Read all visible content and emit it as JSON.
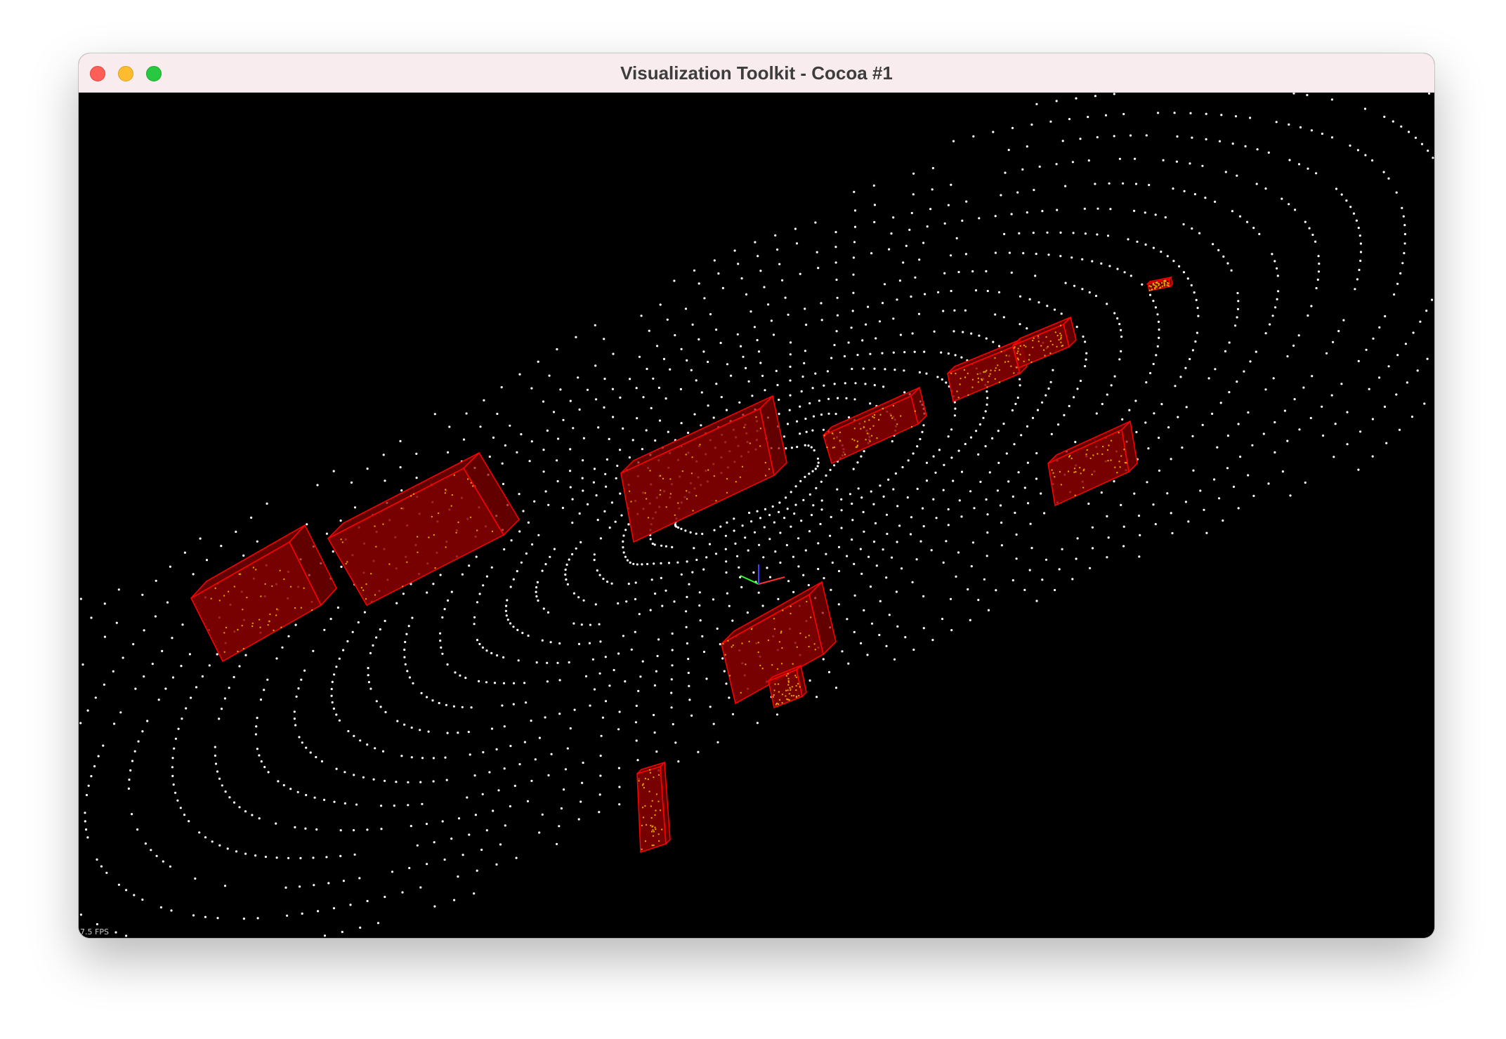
{
  "window": {
    "title": "Visualization Toolkit - Cocoa #1",
    "controls": {
      "close": "close-button",
      "minimize": "minimize-button",
      "zoom": "zoom-button"
    }
  },
  "viewport": {
    "background": "#000000",
    "fps_label": "7.5 FPS",
    "point_color": "#ffffff",
    "box_color": "#ff0000",
    "box_fill": "#8c0000",
    "highlight_point_color": "#ffd400",
    "axes_colors": {
      "x": "#ff3030",
      "y": "#30ff30",
      "z": "#4040ff"
    },
    "detected_object_count": 11
  }
}
